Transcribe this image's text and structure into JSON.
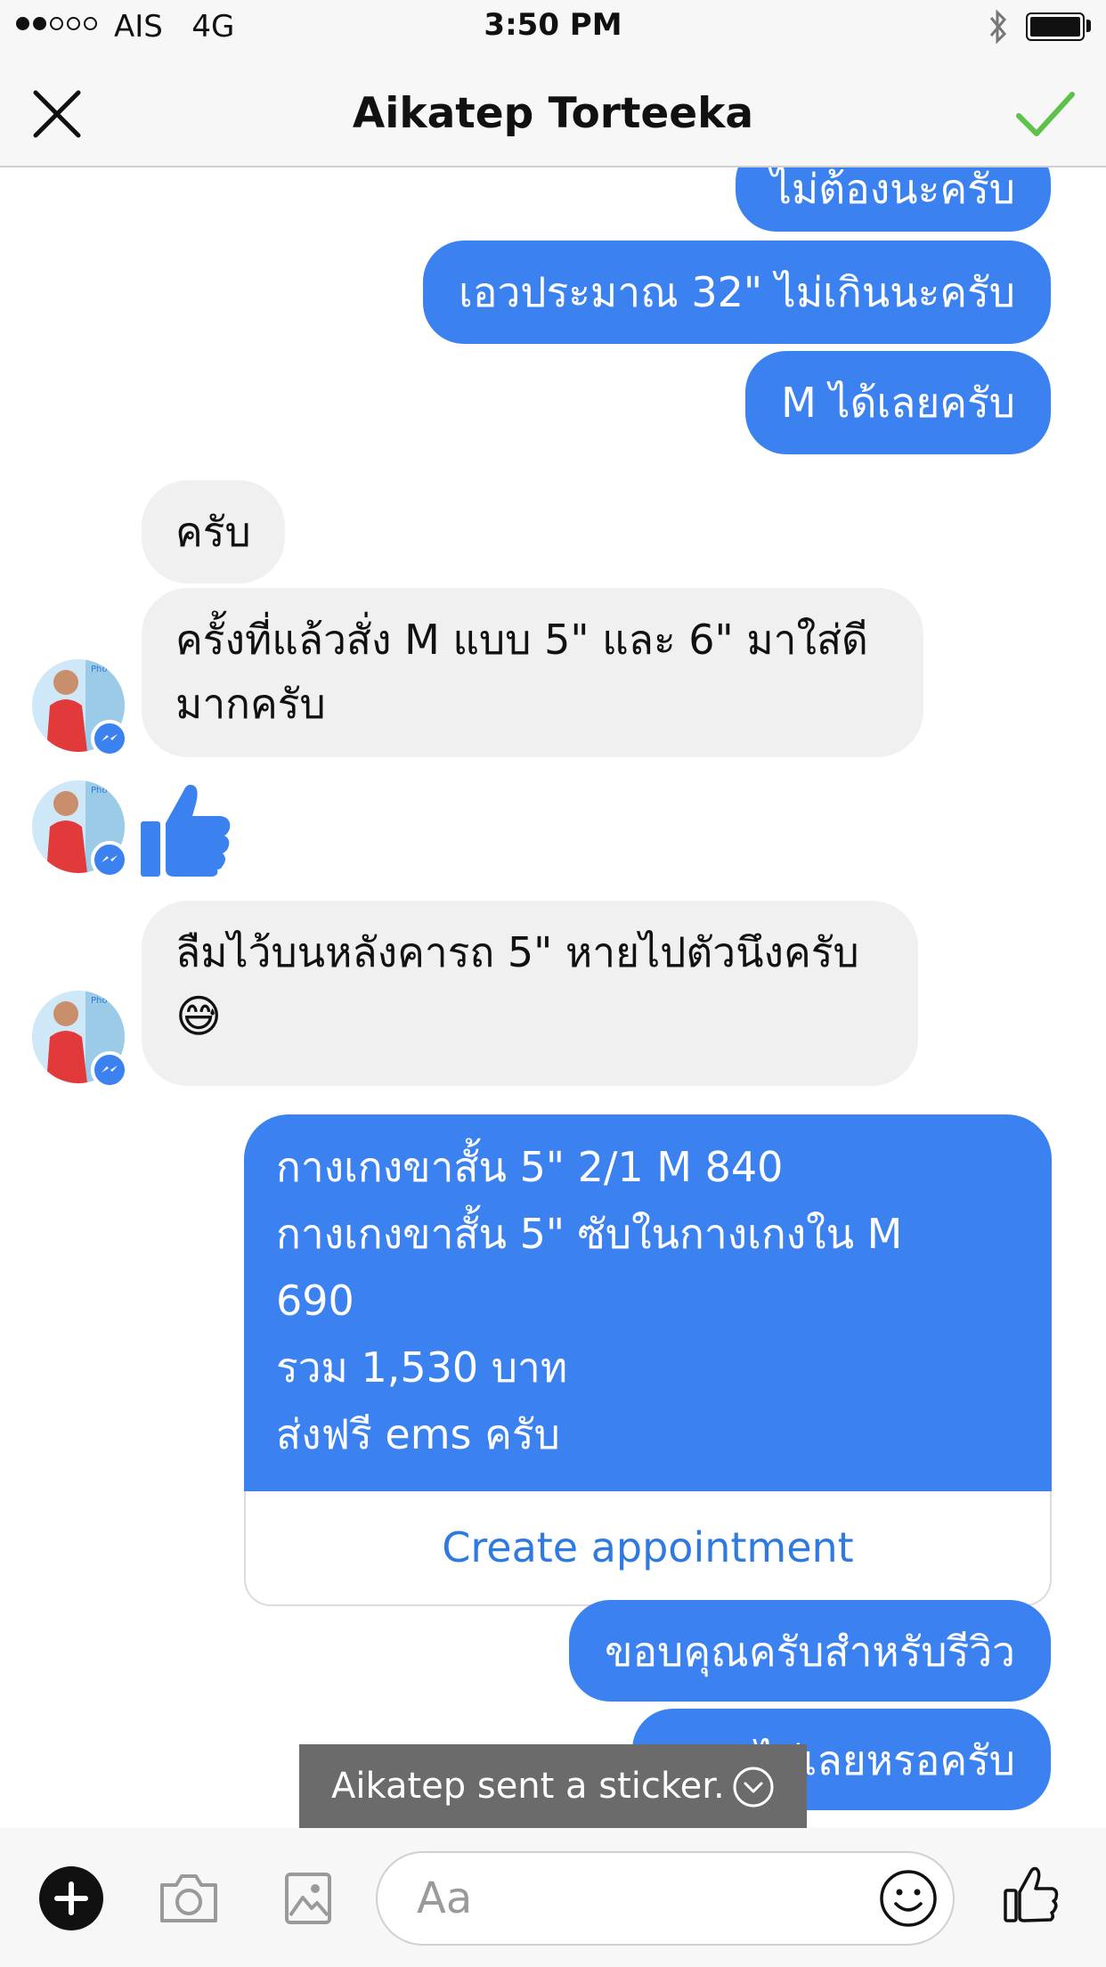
{
  "status_bar": {
    "carrier": "AIS",
    "network": "4G",
    "time": "3:50 PM"
  },
  "header": {
    "title": "Aikatep Torteeka"
  },
  "messages": {
    "out_partial": "ไม่ต้องนะครับ",
    "out_1": "เอวประมาณ 32\" ไม่เกินนะครับ",
    "out_2": "M ได้เลยครับ",
    "in_1": "ครับ",
    "in_2": "ครั้งที่แล้วสั่ง M แบบ 5\" และ 6\" มาใส่ดีมากครับ",
    "in_4_text": "ลืมไว้บนหลังคารถ 5\" หายไปตัวนึงครับ",
    "in_4_emoji": "😅",
    "card_lines": [
      "กางเกงขาสั้น 5\" 2/1 M 840",
      "กางเกงขาสั้น 5\" ซับในกางเกงใน M",
      "690",
      "รวม 1,530 บาท",
      "ส่งฟรี ems ครับ"
    ],
    "card_action": "Create appointment",
    "out_3": "ขอบคุณครับสำหรับรีวิว",
    "out_4": "ไม่เลยหรอครับ"
  },
  "toast": "Aikatep sent a sticker.",
  "composer": {
    "placeholder": "Aa"
  },
  "colors": {
    "outgoing_bubble": "#3b82f0",
    "incoming_bubble": "#f0f0f0",
    "check_green": "#5cc24a",
    "link_blue": "#2f7ae0"
  }
}
